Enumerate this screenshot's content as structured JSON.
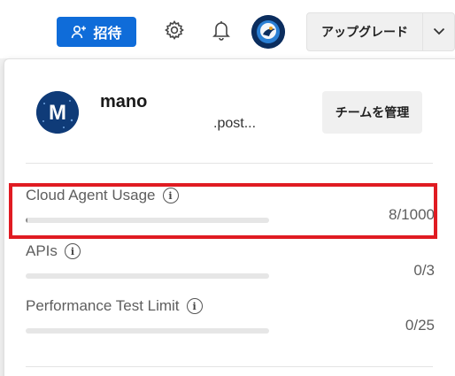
{
  "topbar": {
    "invite_label": "招待",
    "upgrade_label": "アップグレード",
    "icons": {
      "invite": "add-user-icon",
      "settings": "gear-icon",
      "notifications": "bell-icon",
      "upgrade_menu": "chevron-down-icon"
    },
    "colors": {
      "invite_button": "#0f6cd9",
      "avatar_bg": "#0b2d5e"
    }
  },
  "user": {
    "name": "mano",
    "email": ".post...",
    "avatar_letter": "M",
    "manage_team_label": "チームを管理"
  },
  "usage": [
    {
      "label": "Cloud Agent Usage",
      "value": "8/1000",
      "used": 8,
      "limit": 1000
    },
    {
      "label": "APIs",
      "value": "0/3",
      "used": 0,
      "limit": 3
    },
    {
      "label": "Performance Test Limit",
      "value": "0/25",
      "used": 0,
      "limit": 25
    }
  ],
  "highlight_color": "#e01b22"
}
